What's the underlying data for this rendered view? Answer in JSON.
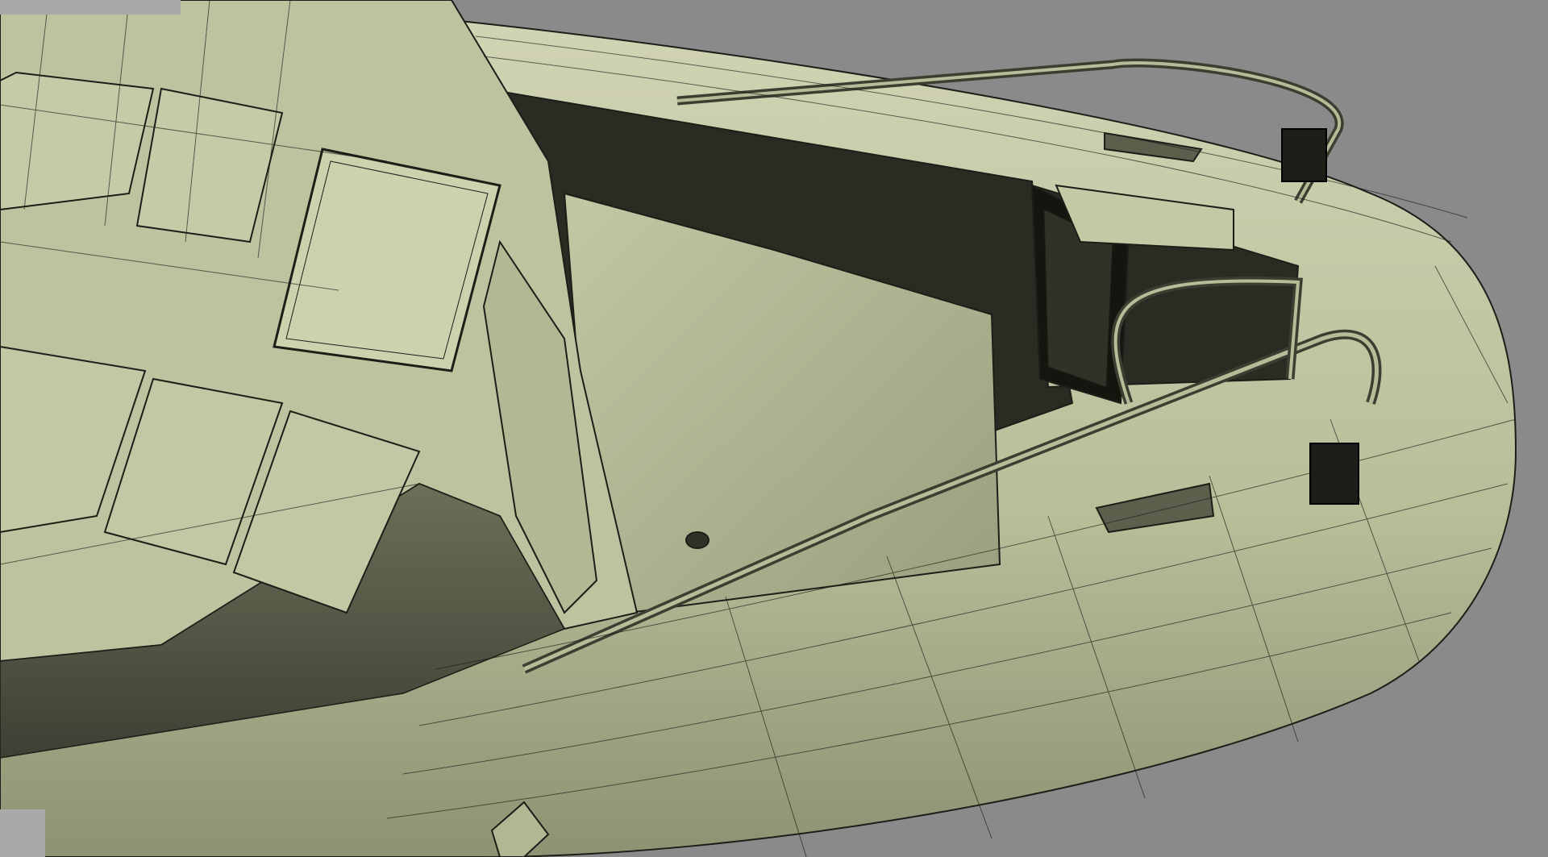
{
  "viewport": {
    "background_color": "#8a8a8a",
    "model_color": "#c9ccaa",
    "interior_color": "#2a2c24",
    "wire_color": "#1c1e18"
  },
  "ui_blocks": {
    "top_left": {
      "color": "#a9a9a9"
    },
    "bottom_left": {
      "color": "#a9a9a9"
    }
  }
}
